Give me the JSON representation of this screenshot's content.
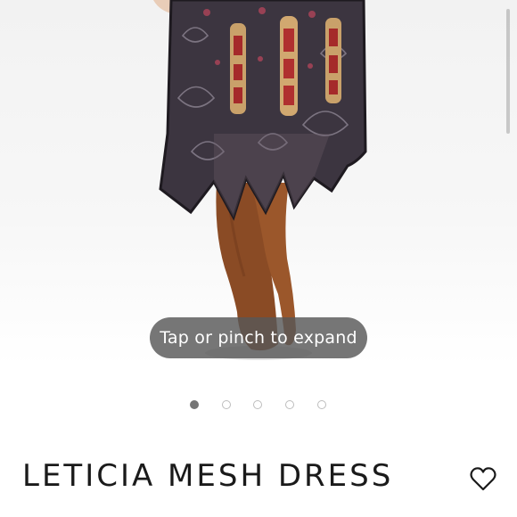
{
  "product": {
    "title": "LETICIA MESH DRESS"
  },
  "gallery": {
    "expand_hint": "Tap or pinch to expand",
    "image_count": 5,
    "active_index": 0
  },
  "icons": {
    "favorite": "heart-outline-icon"
  }
}
